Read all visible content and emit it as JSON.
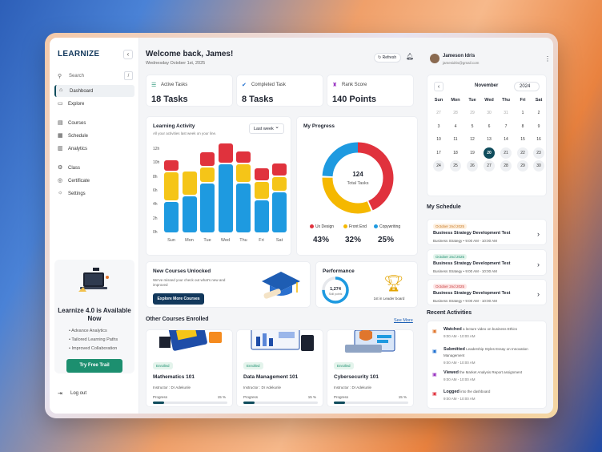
{
  "sidebar": {
    "logo": "LEARNIZE",
    "search_label": "Search",
    "search_shortcut": "/",
    "items": [
      {
        "label": "Dashboard",
        "icon": "home-icon"
      },
      {
        "label": "Explore",
        "icon": "folder-icon"
      },
      {
        "label": "Courses",
        "icon": "book-icon"
      },
      {
        "label": "Schedule",
        "icon": "calendar-icon"
      },
      {
        "label": "Analytics",
        "icon": "chart-icon"
      },
      {
        "label": "Class",
        "icon": "gear-icon"
      },
      {
        "label": "Certificate",
        "icon": "certificate-icon"
      },
      {
        "label": "Settings",
        "icon": "settings-icon"
      }
    ],
    "promo": {
      "title": "Learnize 4.0 is Available Now",
      "features": [
        "Advance Analytics",
        "Tailored Learning Paths",
        "Improved Collaboration"
      ],
      "button": "Try Free Trail"
    },
    "logout": "Log out"
  },
  "header": {
    "title": "Welcome back, James!",
    "date": "Wednesday October 1st, 2025",
    "refresh": "Refresh"
  },
  "stats": [
    {
      "label": "Active Tasks",
      "value": "18 Tasks"
    },
    {
      "label": "Completed Task",
      "value": "8 Tasks"
    },
    {
      "label": "Rank Score",
      "value": "140 Points"
    }
  ],
  "activity": {
    "title": "Learning Activity",
    "subtitle": "All your activities last week on your line.",
    "range": "Last week"
  },
  "chart_data": {
    "type": "bar",
    "title": "Learning Activity",
    "categories": [
      "Sun",
      "Mon",
      "Tue",
      "Wed",
      "Thu",
      "Fri",
      "Sat"
    ],
    "y_ticks": [
      "0h",
      "2h",
      "4h",
      "6h",
      "8h",
      "10h",
      "12h"
    ],
    "ylim": [
      0,
      12
    ],
    "stacked": true,
    "series": [
      {
        "color": "#1e9ae0",
        "values": [
          4.6,
          5.4,
          7.3,
          10.0,
          7.3,
          4.8,
          6.0
        ]
      },
      {
        "color": "#f5c518",
        "values": [
          4.3,
          3.6,
          2.3,
          0,
          2.7,
          2.7,
          2.2
        ]
      },
      {
        "color": "#e0323d",
        "values": [
          1.7,
          0,
          2.2,
          3.0,
          1.9,
          2.0,
          1.9
        ]
      }
    ]
  },
  "progress": {
    "title": "My Progress",
    "center_value": "124",
    "center_label": "Total Tasks",
    "items": [
      {
        "label": "Ux Design",
        "value": "43%",
        "color": "#e0323d"
      },
      {
        "label": "Front End",
        "value": "32%",
        "color": "#f5b800"
      },
      {
        "label": "Copywriting",
        "value": "25%",
        "color": "#1e9ae0"
      }
    ]
  },
  "new_courses": {
    "title": "New Courses Unlocked",
    "text": "We've missed your check out what's new and improved",
    "button": "Explore More Courses"
  },
  "performance": {
    "title": "Performance",
    "value": "1,274",
    "unit": "Skill points",
    "rank": "1st in Leader board",
    "fraction": 0.75
  },
  "courses": {
    "title": "Other Courses Enrolled",
    "see_more": "See More",
    "items": [
      {
        "badge": "Enrolled",
        "name": "Mathematics 101",
        "instructor": "Instructor : Dr Adekunle",
        "progress_label": "Progress",
        "progress": "15 %"
      },
      {
        "badge": "Enrolled",
        "name": "Data Management 101",
        "instructor": "Instructor : Dr Adekunle",
        "progress_label": "Progress",
        "progress": "15 %"
      },
      {
        "badge": "Enrolled",
        "name": "Cybersecurity 101",
        "instructor": "Instructor : Dr Adekunle",
        "progress_label": "Progress",
        "progress": "15 %"
      }
    ]
  },
  "user": {
    "name": "Jameson Idris",
    "email": "jamesidris@gmail.com"
  },
  "calendar": {
    "month": "November",
    "year": "2024",
    "days": [
      "Sun",
      "Mon",
      "Tue",
      "Wed",
      "Thu",
      "Fri",
      "Sat"
    ],
    "weeks": [
      [
        "27",
        "28",
        "29",
        "30",
        "31",
        "1",
        "2"
      ],
      [
        "3",
        "4",
        "5",
        "6",
        "7",
        "8",
        "9"
      ],
      [
        "10",
        "11",
        "12",
        "13",
        "14",
        "15",
        "16"
      ],
      [
        "17",
        "18",
        "19",
        "20",
        "21",
        "22",
        "23"
      ],
      [
        "24",
        "25",
        "26",
        "27",
        "28",
        "29",
        "30"
      ]
    ],
    "today": "20"
  },
  "schedule": {
    "title": "My Schedule",
    "items": [
      {
        "date": "October 2nd 2025",
        "title": "Business Strategy Development Test",
        "meta": "Business Strategy  •  9:00 AM - 10:00 AM",
        "tag_color": "#c7741a",
        "tag_bg": "#fdf0e0"
      },
      {
        "date": "October 2nd 2025",
        "title": "Business Strategy Development Test",
        "meta": "Business Strategy  •  9:00 AM - 10:00 AM",
        "tag_color": "#1c8f6f",
        "tag_bg": "#e4f4ec"
      },
      {
        "date": "October 2nd 2025",
        "title": "Business Strategy Development Test",
        "meta": "Business Strategy  •  9:00 AM - 10:00 AM",
        "tag_color": "#c73535",
        "tag_bg": "#fde6e6"
      }
    ]
  },
  "activities": {
    "title": "Recent Activities",
    "items": [
      {
        "verb": "Watched",
        "text": "a lecture video on business Ethics",
        "time": "9:00 AM - 10:00 AM",
        "color": "#e0762d"
      },
      {
        "verb": "Submitted",
        "text": "Leadership Styles Essay on Innovation Management",
        "time": "9:00 AM - 10:00 AM",
        "color": "#1e6fd0"
      },
      {
        "verb": "Viewed",
        "text": "the Market Analysis Report assignment",
        "time": "9:00 AM - 10:00 AM",
        "color": "#9a36c2"
      },
      {
        "verb": "Logged",
        "text": "into the dashboard",
        "time": "9:00 AM - 10:00 AM",
        "color": "#e0323d"
      }
    ]
  }
}
